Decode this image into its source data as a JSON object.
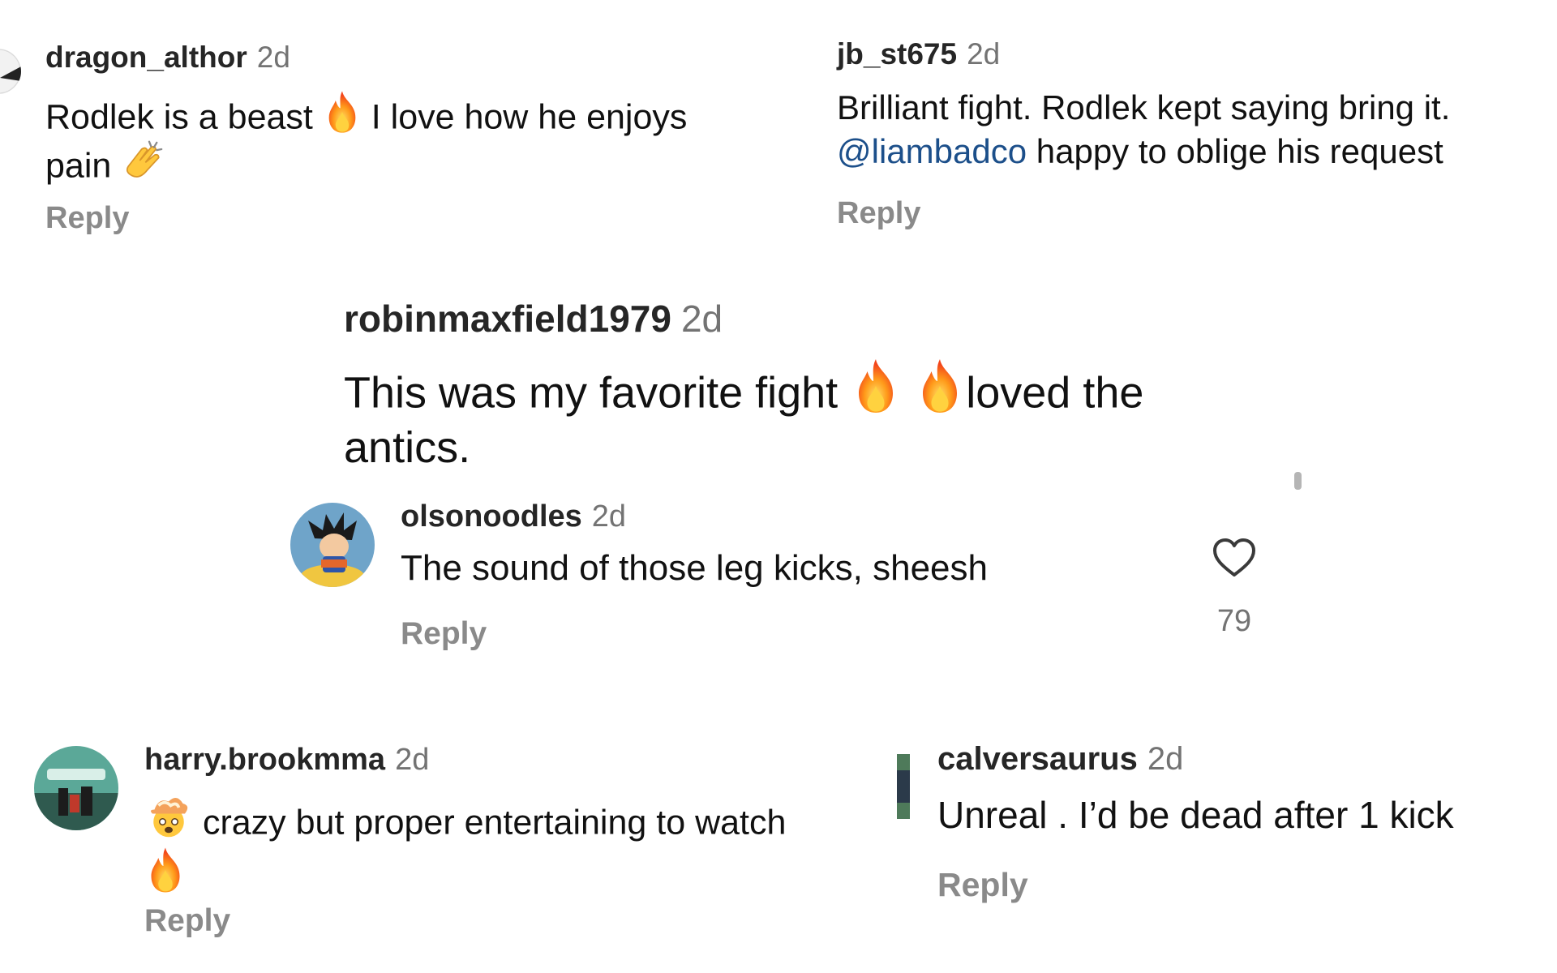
{
  "comments": {
    "c1": {
      "username": "dragon_althor",
      "time": "2d",
      "text_a": "Rodlek is a beast ",
      "emoji_1": "fire-emoji",
      "text_b": " I love how he enjoys",
      "text_c": "pain ",
      "emoji_2": "clapping-hands-emoji",
      "reply": "Reply"
    },
    "c2": {
      "username": "jb_st675",
      "time": "2d",
      "text_a": "Brilliant fight. Rodlek kept saying bring it.",
      "mention": "@liambadco",
      "text_b": " happy to oblige his request",
      "reply": "Reply"
    },
    "c3": {
      "username": "robinmaxfield1979",
      "time": "2d",
      "text_a": "This was my favorite fight ",
      "emoji_1": "fire-emoji",
      "emoji_2": "fire-emoji",
      "text_b": "loved the",
      "text_c": "antics."
    },
    "c4": {
      "username": "olsonoodles",
      "time": "2d",
      "text": "The sound of those leg kicks, sheesh",
      "reply": "Reply",
      "like_icon": "heart-icon",
      "like_count": "79"
    },
    "c5": {
      "username": "harry.brookmma",
      "time": "2d",
      "emoji_1": "exploding-head-emoji",
      "text": " crazy but proper entertaining to watch",
      "emoji_2": "fire-emoji",
      "reply": "Reply"
    },
    "c6": {
      "username": "calversaurus",
      "time": "2d",
      "text": "Unreal . I’d be dead after 1 kick",
      "reply": "Reply"
    }
  },
  "colors": {
    "username": "#262626",
    "meta": "#737373",
    "reply": "#8a8a8a",
    "mention": "#1c4f8a"
  }
}
